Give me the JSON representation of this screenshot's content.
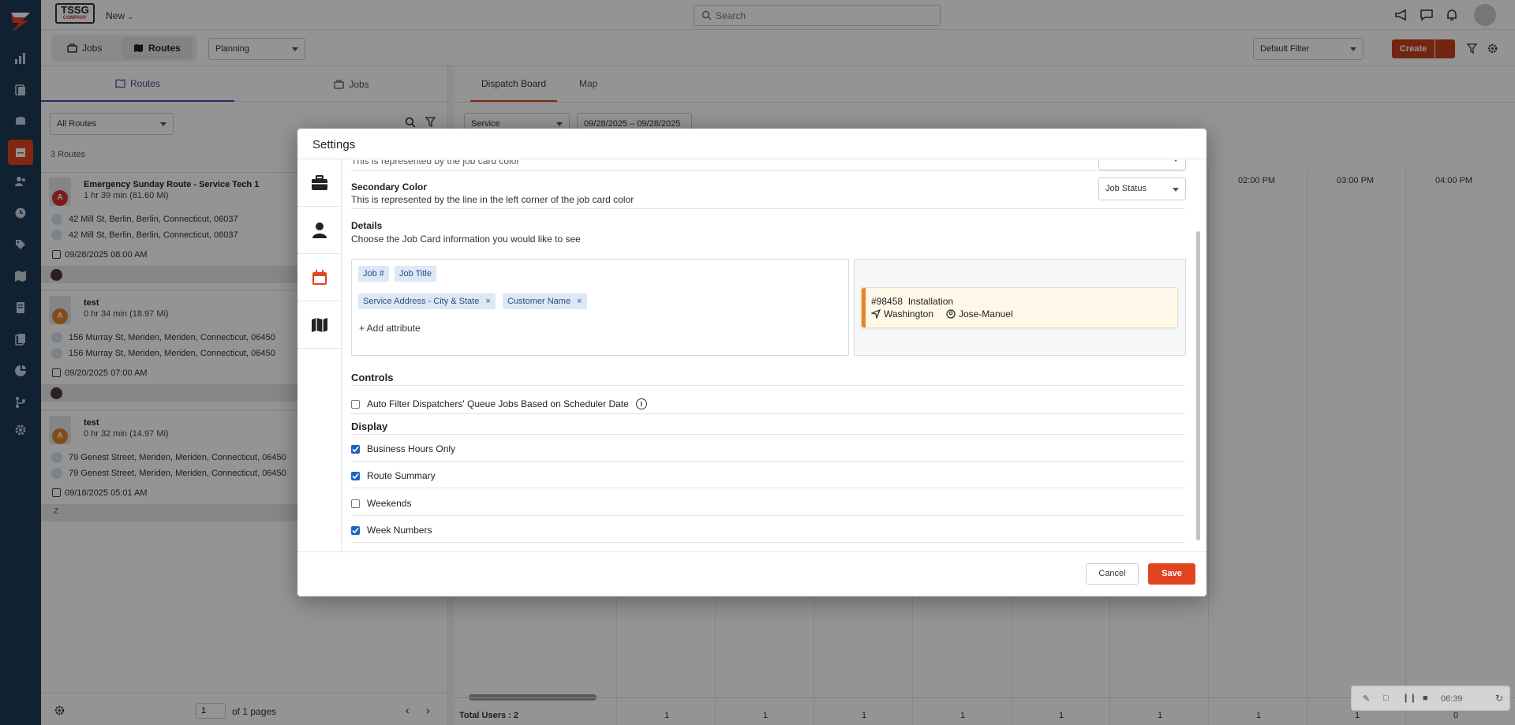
{
  "topbar": {
    "brand": "TSSG",
    "brand_sub": "COMPANY",
    "new_label": "New",
    "search_placeholder": "Search"
  },
  "subbar": {
    "seg_jobs": "Jobs",
    "seg_routes": "Routes",
    "planning": "Planning",
    "default_filter": "Default Filter",
    "create": "Create"
  },
  "left_panel": {
    "tab_routes": "Routes",
    "tab_jobs": "Jobs",
    "filter": "All Routes",
    "count": "3 Routes",
    "routes": [
      {
        "letter": "A",
        "color": "#d6332b",
        "title": "Emergency Sunday Route - Service Tech 1",
        "duration": "1 hr 39 min (81.60 Mi)",
        "addr1": "42 Mill St, Berlin, Berlin, Connecticut, 06037",
        "addr2": "42 Mill St, Berlin, Berlin, Connecticut, 06037",
        "date": "09/28/2025 08:00 AM"
      },
      {
        "letter": "A",
        "color": "#e28426",
        "title": "test",
        "duration": "0 hr 34 min (18.97 Mi)",
        "addr1": "156 Murray St, Meriden, Meriden, Connecticut, 06450",
        "addr2": "156 Murray St, Meriden, Meriden, Connecticut, 06450",
        "date": "09/20/2025 07:00 AM"
      },
      {
        "letter": "A",
        "color": "#e28426",
        "title": "test",
        "duration": "0 hr 32 min (14.97 Mi)",
        "addr1": "79 Genest Street, Meriden, Meriden, Connecticut, 06450",
        "addr2": "79 Genest Street, Meriden, Meriden, Connecticut, 06450",
        "date": "09/18/2025 05:01 AM",
        "initial": "Z"
      }
    ],
    "page_value": "1",
    "page_of": "of 1 pages"
  },
  "right_panel": {
    "tab_dispatch": "Dispatch Board",
    "tab_map": "Map",
    "service": "Service",
    "date_range": "09/28/2025 – 09/28/2025",
    "hours": [
      "02:00 PM",
      "03:00 PM",
      "04:00 PM"
    ],
    "total_users": "Total Users : 2",
    "counts": [
      "1",
      "1",
      "1",
      "1",
      "1",
      "1",
      "1",
      "1",
      "0"
    ]
  },
  "modal": {
    "title": "Settings",
    "primary_desc_partial": "This is represented by the job card color",
    "secondary_title": "Secondary Color",
    "secondary_desc": "This is represented by the line in the left corner of the job card color",
    "secondary_value": "Job Status",
    "details_title": "Details",
    "details_desc": "Choose the Job Card information you would like to see",
    "chips": [
      "Job #",
      "Job Title",
      "Service Address - City & State",
      "Customer Name"
    ],
    "add_attribute": "+ Add attribute",
    "preview": {
      "job_no": "#98458",
      "job_title": "Installation",
      "city": "Washington",
      "customer": "Jose-Manuel"
    },
    "controls_title": "Controls",
    "controls": [
      {
        "label": "Auto Filter Dispatchers' Queue Jobs Based on Scheduler Date",
        "checked": false
      }
    ],
    "display_title": "Display",
    "display": [
      {
        "label": "Business Hours Only",
        "checked": true
      },
      {
        "label": "Route Summary",
        "checked": true
      },
      {
        "label": "Weekends",
        "checked": false
      },
      {
        "label": "Week Numbers",
        "checked": true
      }
    ],
    "cancel": "Cancel",
    "save": "Save"
  },
  "recorder": {
    "time": "06:39"
  },
  "colors": {
    "accent": "#e0451f",
    "nav": "#1c3a57",
    "link": "#3d4bab"
  }
}
